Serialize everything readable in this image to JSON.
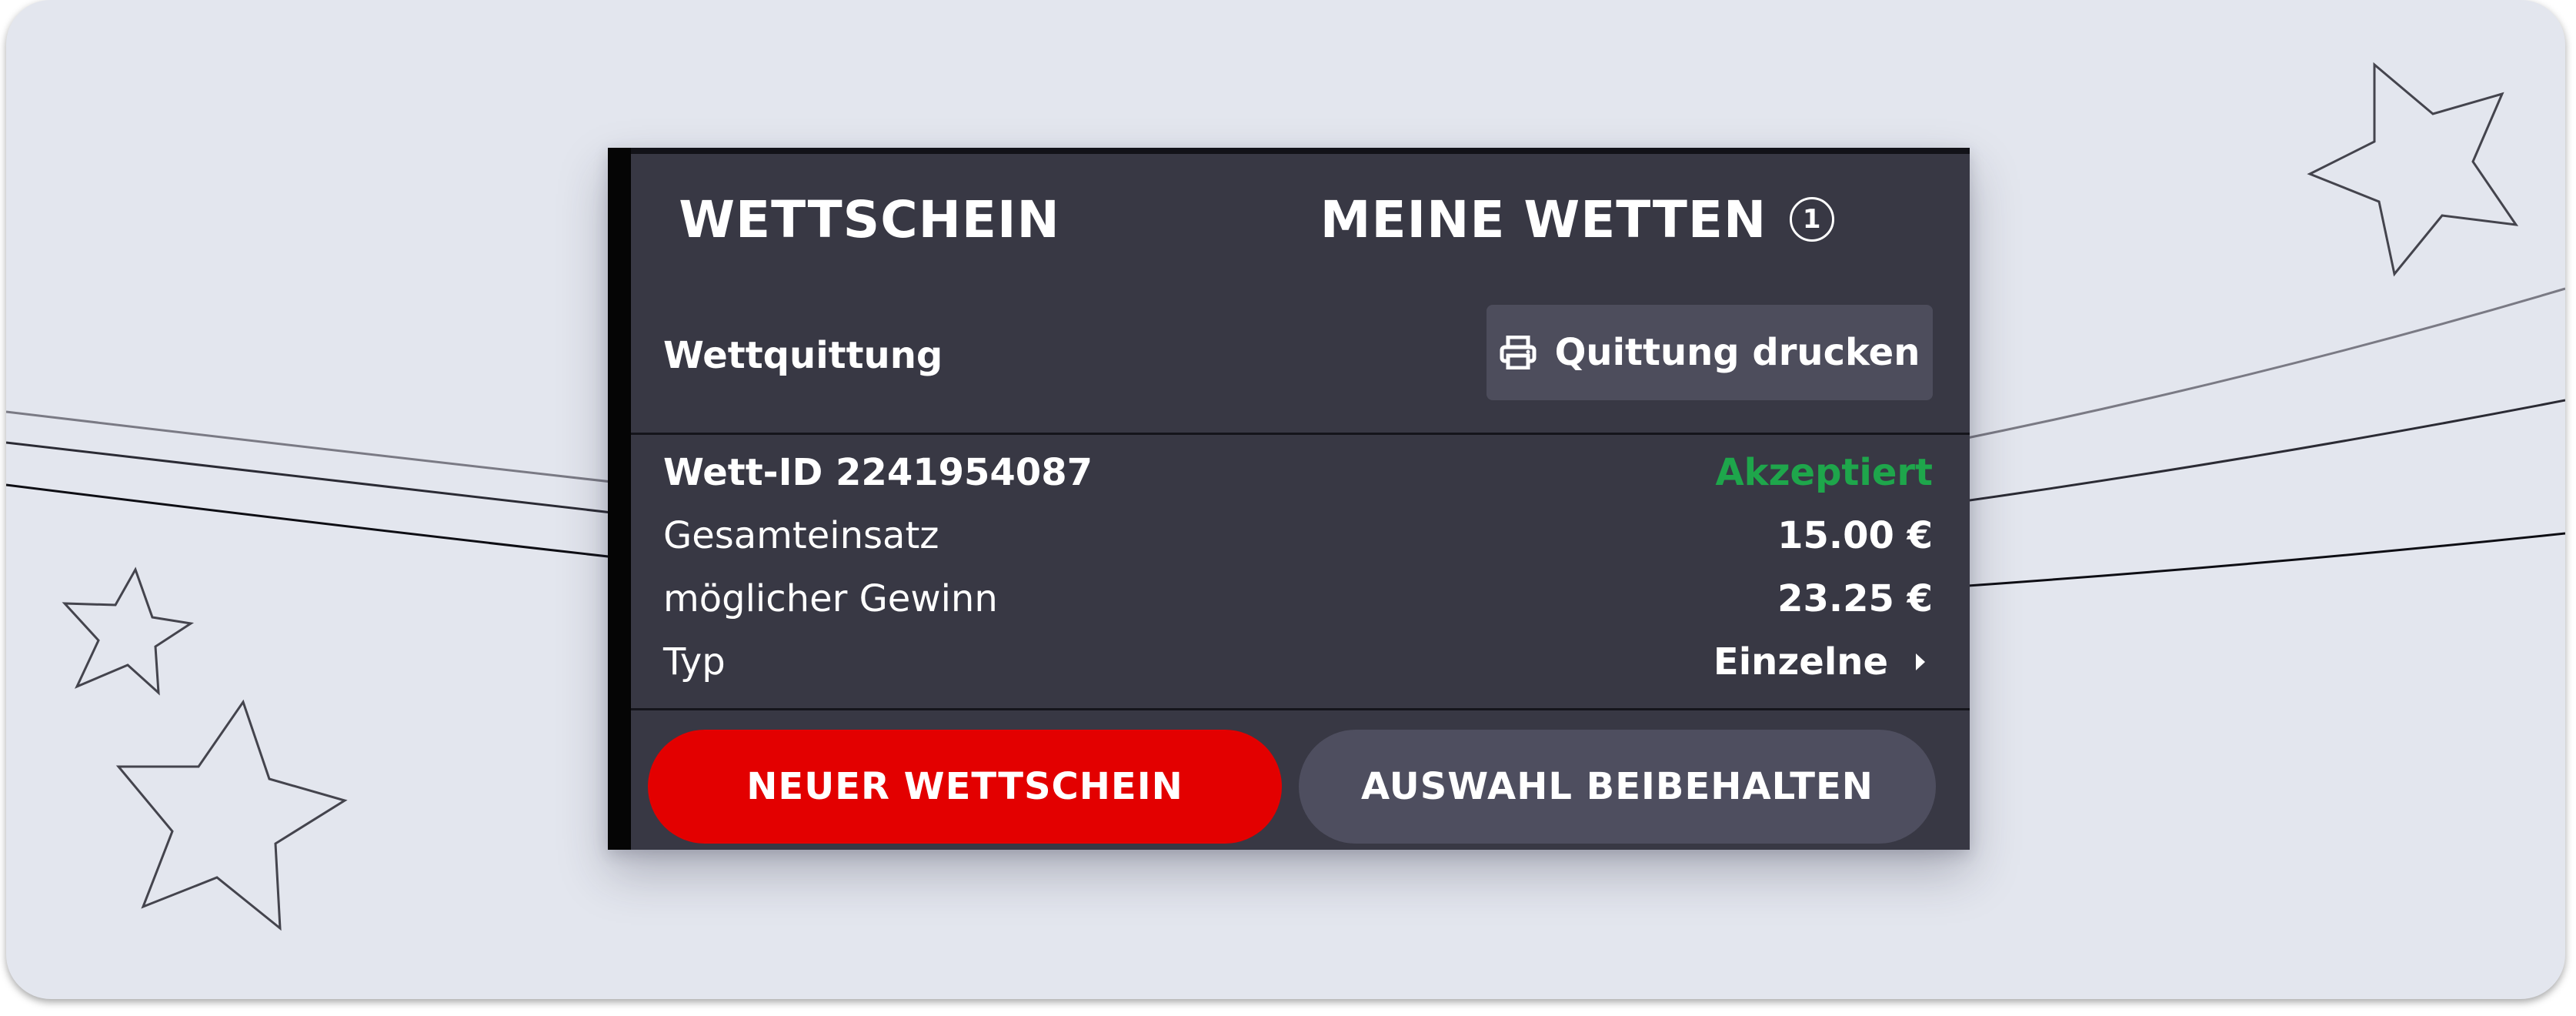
{
  "tabs": {
    "betslip": "WETTSCHEIN",
    "my_bets": "MEINE WETTEN",
    "my_bets_count": "1"
  },
  "receipt": {
    "title": "Wettquittung",
    "print_button_label": "Quittung drucken",
    "print_icon": "printer-icon"
  },
  "bet": {
    "id_label": "Wett-ID 2241954087",
    "status": "Akzeptiert",
    "status_color": "#1ea64b",
    "stake_label": "Gesamteinsatz",
    "stake_value": "15.00 €",
    "winnings_label": "möglicher Gewinn",
    "winnings_value": "23.25 €",
    "type_label": "Typ",
    "type_value": "Einzelne",
    "type_icon": "caret-right-icon"
  },
  "actions": {
    "new_betslip": "NEUER WETTSCHEIN",
    "keep_selection": "AUSWAHL BEIBEHALTEN"
  },
  "colors": {
    "background": "#e3e6ee",
    "panel": "#383844",
    "accent_red": "#e30000",
    "secondary_button": "#4e4e5f"
  }
}
